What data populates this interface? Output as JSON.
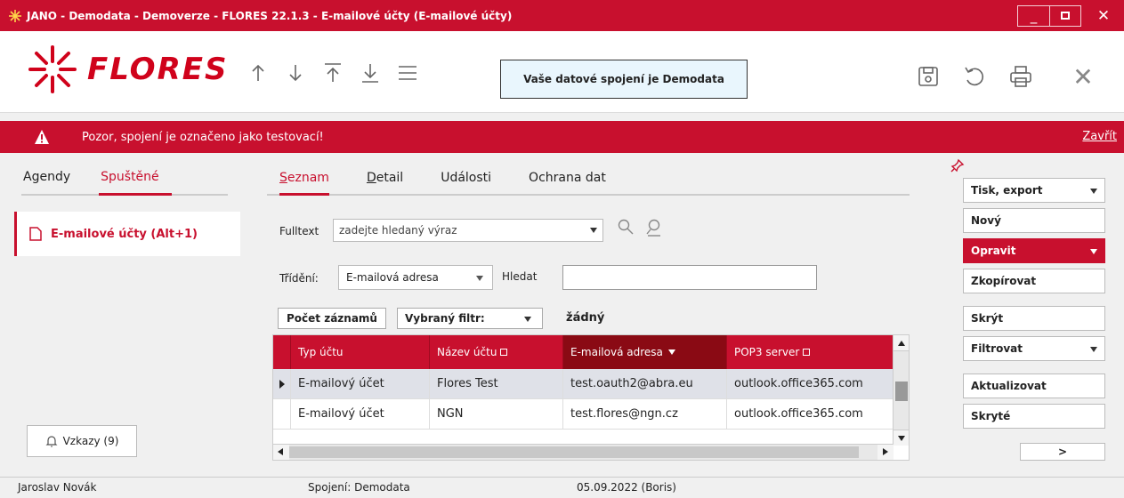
{
  "window": {
    "title": "JANO - Demodata - Demoverze - FLORES 22.1.3 - E-mailové účty  (E-mailové účty)",
    "min": "_",
    "close": "✕"
  },
  "logo": {
    "word": "FLORES",
    "color": "#d0021b"
  },
  "toolbar": {
    "connection_label": "Vaše datové spojení je Demodata"
  },
  "warning": {
    "message": "Pozor, spojení je označeno jako testovací!",
    "close_label": "Zavřít"
  },
  "left": {
    "tabs": [
      {
        "label": "Agendy"
      },
      {
        "label": "Spuštěné"
      }
    ],
    "open_item": "E-mailové účty (Alt+1)",
    "messages_button": "Vzkazy (9)"
  },
  "center": {
    "tabs": [
      {
        "label": "Seznam",
        "underline": "S",
        "rest": "eznam"
      },
      {
        "label": "Detail",
        "underline": "D",
        "rest": "etail"
      },
      {
        "label": "Události"
      },
      {
        "label": "Ochrana dat"
      }
    ],
    "fulltext": {
      "label": "Fulltext",
      "placeholder": "zadejte hledaný výraz"
    },
    "sort": {
      "label": "Třídění:",
      "value": "E-mailová adresa"
    },
    "search": {
      "label": "Hledat",
      "value": ""
    },
    "count_button": "Počet záznamů",
    "filter_button": "Vybraný filtr:",
    "filter_value": "žádný",
    "grid": {
      "columns": [
        "Typ účtu",
        "Název účtu",
        "E-mailová adresa",
        "POP3 server"
      ],
      "rows": [
        [
          "E-mailový účet",
          "Flores Test",
          "test.oauth2@abra.eu",
          "outlook.office365.com"
        ],
        [
          "E-mailový účet",
          "NGN",
          "test.flores@ngn.cz",
          "outlook.office365.com"
        ]
      ]
    }
  },
  "right": {
    "buttons": [
      {
        "label": "Tisk, export"
      },
      {
        "label": "Nový"
      },
      {
        "label": "Opravit"
      },
      {
        "label": "Zkopírovat"
      },
      {
        "label": "Skrýt"
      },
      {
        "label": "Filtrovat"
      },
      {
        "label": "Aktualizovat"
      },
      {
        "label": "Skryté"
      },
      {
        "label": ">"
      }
    ]
  },
  "status": {
    "user": "Jaroslav Novák",
    "connection": "Spojení: Demodata",
    "date": "05.09.2022 (Boris)"
  }
}
